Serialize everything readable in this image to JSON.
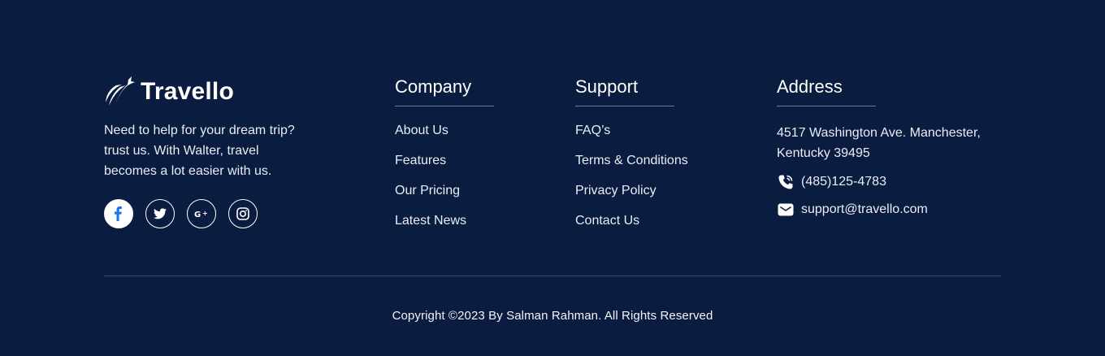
{
  "brand": {
    "name": "Travello",
    "tagline_lines": [
      "Need to help for your dream trip?",
      "trust us. With Walter, travel",
      "becomes a lot easier with us."
    ],
    "socials": [
      {
        "icon": "facebook-icon",
        "active": true
      },
      {
        "icon": "twitter-icon",
        "active": false
      },
      {
        "icon": "google-plus-icon",
        "active": false
      },
      {
        "icon": "instagram-icon",
        "active": false
      }
    ]
  },
  "company": {
    "title": "Company",
    "links": [
      "About Us",
      "Features",
      "Our Pricing",
      "Latest News"
    ]
  },
  "support": {
    "title": "Support",
    "links": [
      "FAQ’s",
      "Terms & Conditions",
      "Privacy Policy",
      "Contact Us"
    ]
  },
  "address": {
    "title": "Address",
    "lines": [
      "4517 Washington Ave. Manchester,",
      "Kentucky 39495"
    ],
    "phone": "(485)125-4783",
    "email": "support@travello.com"
  },
  "copyright": "Copyright ©2023 By Salman Rahman. All Rights Reserved",
  "colors": {
    "background": "#0a1c3f",
    "text": "#ffffff",
    "facebook_active": "#1877f2"
  }
}
